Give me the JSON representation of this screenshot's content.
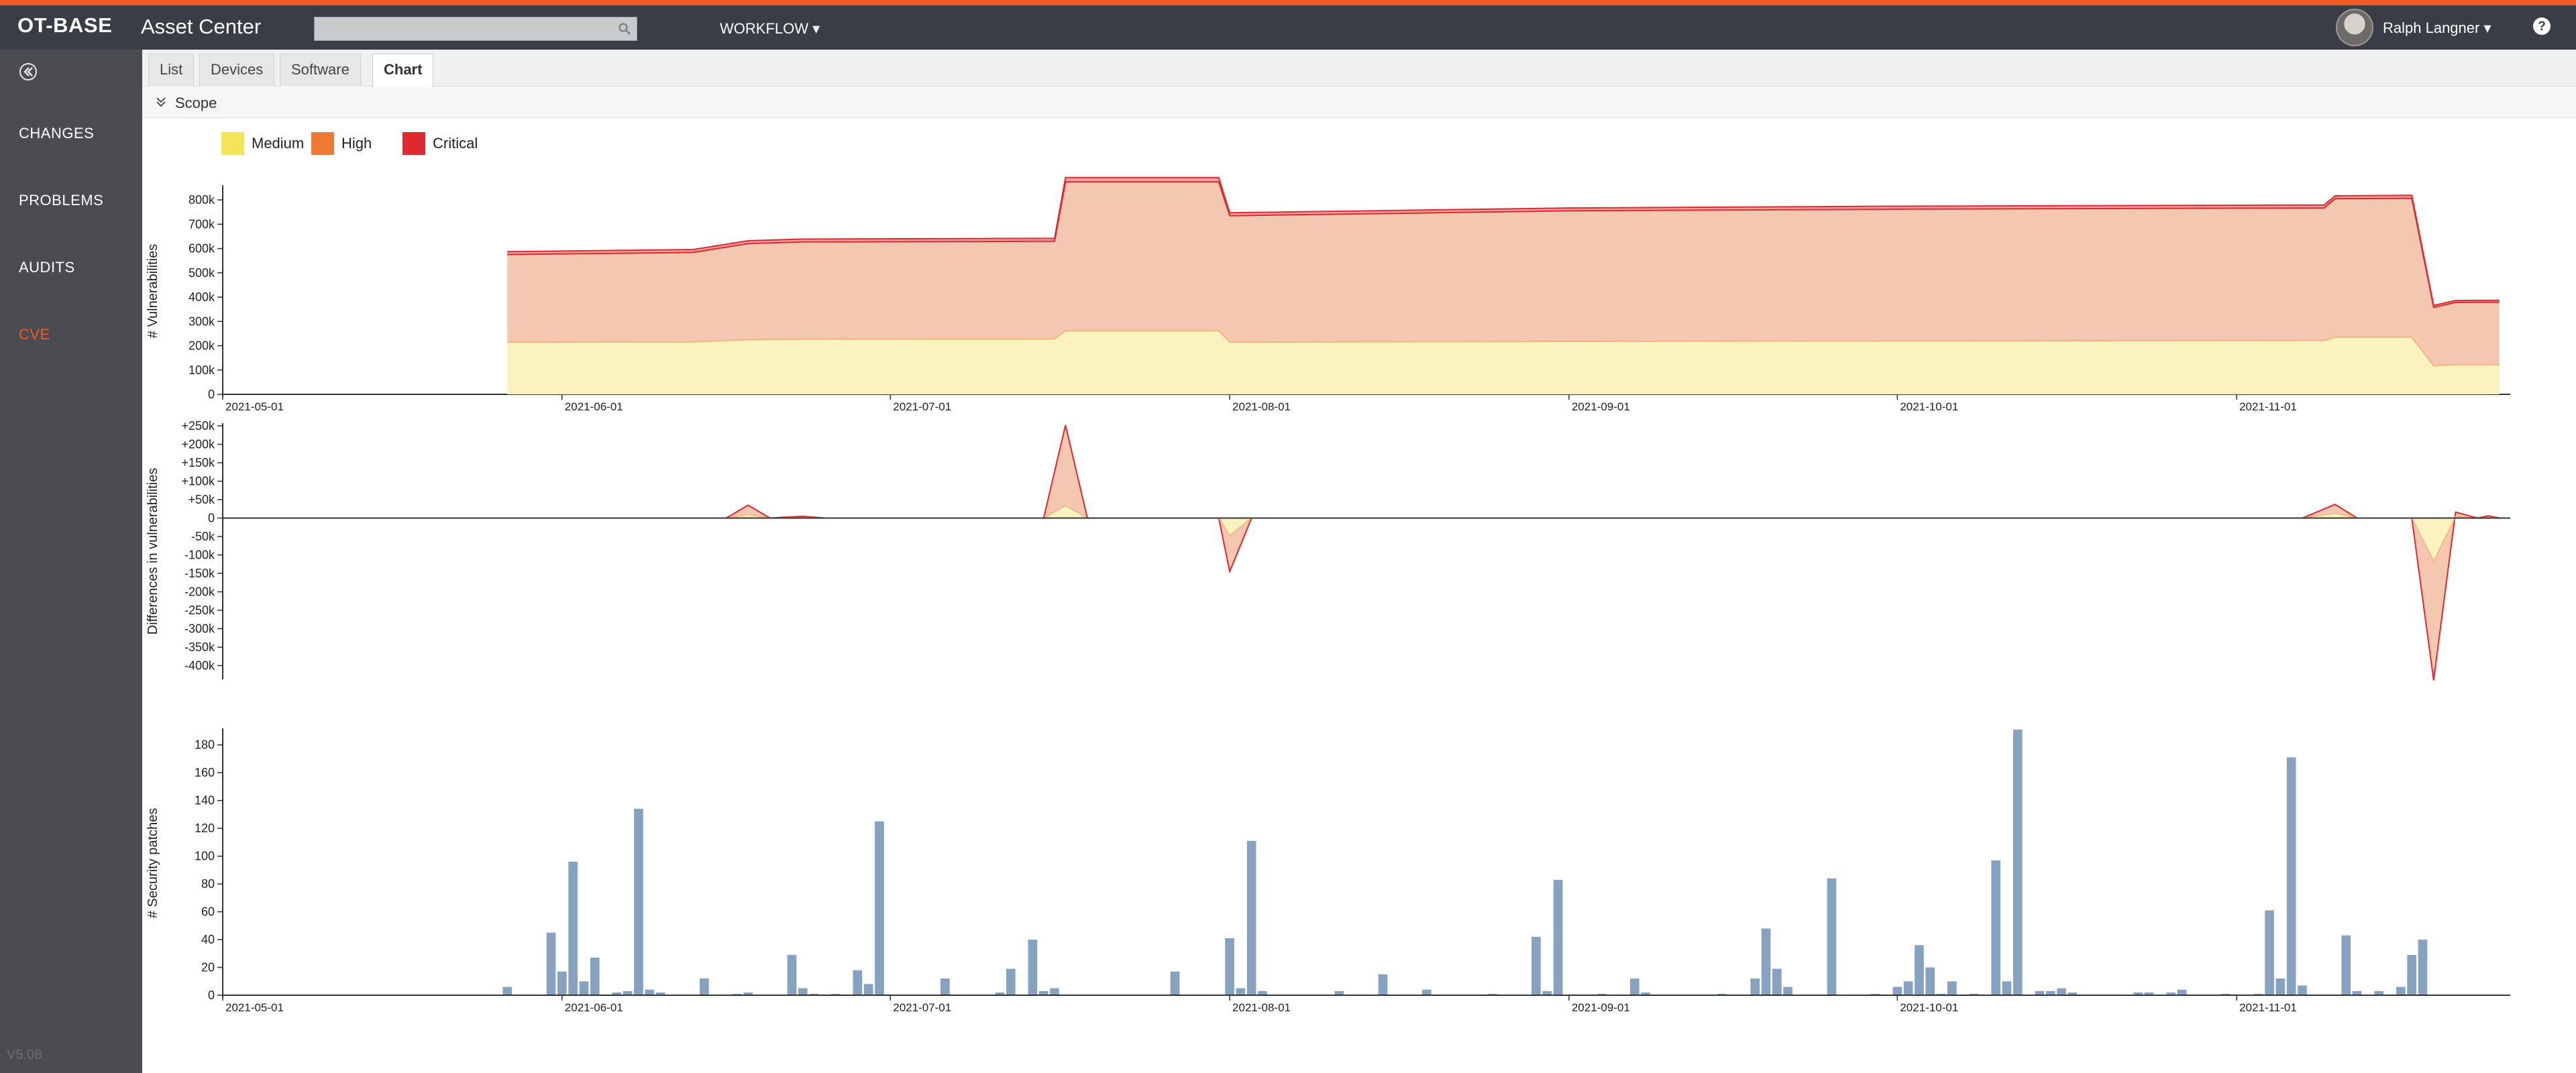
{
  "header": {
    "brand": "OT-BASE",
    "app_name": "Asset Center",
    "search": {
      "value": "",
      "placeholder": ""
    },
    "workflow_label": "WORKFLOW ▾",
    "user_name": "Ralph Langner ▾"
  },
  "sidebar": {
    "items": [
      {
        "label": "CHANGES",
        "active": false
      },
      {
        "label": "PROBLEMS",
        "active": false
      },
      {
        "label": "AUDITS",
        "active": false
      },
      {
        "label": "CVE",
        "active": true
      }
    ],
    "version": "V5.08"
  },
  "tabs": [
    {
      "label": "List",
      "active": false
    },
    {
      "label": "Devices",
      "active": false
    },
    {
      "label": "Software",
      "active": false
    },
    {
      "label": "Chart",
      "active": true
    }
  ],
  "scope": {
    "label": "Scope"
  },
  "colors": {
    "accent": "#f15a22",
    "medium": "#f5e556",
    "high": "#ee7a33",
    "critical": "#dc2a30",
    "medium_fill": "#faf3bf",
    "high_fill": "#f4c7b0",
    "bars": "#87a2c0"
  },
  "chart_data": [
    {
      "type": "area",
      "stacked": true,
      "ylabel": "# Vulnerabilities",
      "x_ticks": [
        "2021-05-01",
        "2021-06-01",
        "2021-07-01",
        "2021-08-01",
        "2021-09-01",
        "2021-10-01",
        "2021-11-01"
      ],
      "y_ticks": [
        "0",
        "100k",
        "200k",
        "300k",
        "400k",
        "500k",
        "600k",
        "700k",
        "800k"
      ],
      "ylim": [
        0,
        850000
      ],
      "legend": [
        "Medium",
        "High",
        "Critical"
      ],
      "points": [
        {
          "x": "2021-05-27",
          "medium": 215000,
          "high": 360000,
          "critical": 12000
        },
        {
          "x": "2021-06-13",
          "medium": 216000,
          "high": 368000,
          "critical": 12000
        },
        {
          "x": "2021-06-18",
          "medium": 225000,
          "high": 395000,
          "critical": 12000
        },
        {
          "x": "2021-06-23",
          "medium": 227000,
          "high": 400000,
          "critical": 12000
        },
        {
          "x": "2021-07-16",
          "medium": 228000,
          "high": 402000,
          "critical": 12000
        },
        {
          "x": "2021-07-17",
          "medium": 262000,
          "high": 612000,
          "critical": 18000
        },
        {
          "x": "2021-07-31",
          "medium": 262000,
          "high": 612000,
          "critical": 18000
        },
        {
          "x": "2021-08-01",
          "medium": 215000,
          "high": 520000,
          "critical": 12000
        },
        {
          "x": "2021-09-01",
          "medium": 218000,
          "high": 537000,
          "critical": 12000
        },
        {
          "x": "2021-10-01",
          "medium": 220000,
          "high": 542000,
          "critical": 12000
        },
        {
          "x": "2021-11-09",
          "medium": 222000,
          "high": 545000,
          "critical": 12000
        },
        {
          "x": "2021-11-10",
          "medium": 235000,
          "high": 570000,
          "critical": 12000
        },
        {
          "x": "2021-11-17",
          "medium": 235000,
          "high": 572000,
          "critical": 12000
        },
        {
          "x": "2021-11-19",
          "medium": 118000,
          "high": 240000,
          "critical": 8000
        },
        {
          "x": "2021-11-21",
          "medium": 122000,
          "high": 256000,
          "critical": 8000
        },
        {
          "x": "2021-11-25",
          "medium": 122000,
          "high": 257000,
          "critical": 8000
        }
      ]
    },
    {
      "type": "area",
      "ylabel": "Differences in vulnerabilities",
      "x_ticks": [],
      "y_ticks": [
        "+250k",
        "+200k",
        "+150k",
        "+100k",
        "+50k",
        "0",
        "-50k",
        "-100k",
        "-150k",
        "-200k",
        "-250k",
        "-300k",
        "-350k",
        "-400k"
      ],
      "ylim": [
        -420000,
        260000
      ],
      "legend": [
        "Medium",
        "High",
        "Critical"
      ],
      "points": [
        {
          "x": "2021-05-27",
          "medium": 0,
          "total": 0
        },
        {
          "x": "2021-06-16",
          "medium": 0,
          "total": 0
        },
        {
          "x": "2021-06-18",
          "medium": 9000,
          "total": 35000
        },
        {
          "x": "2021-06-20",
          "medium": 0,
          "total": 0
        },
        {
          "x": "2021-06-23",
          "medium": 1500,
          "total": 5000
        },
        {
          "x": "2021-06-25",
          "medium": 0,
          "total": 0
        },
        {
          "x": "2021-07-15",
          "medium": 0,
          "total": 0
        },
        {
          "x": "2021-07-17",
          "medium": 34000,
          "total": 252000
        },
        {
          "x": "2021-07-19",
          "medium": 0,
          "total": 0
        },
        {
          "x": "2021-07-31",
          "medium": 0,
          "total": 0
        },
        {
          "x": "2021-08-01",
          "medium": -47000,
          "total": -145000
        },
        {
          "x": "2021-08-03",
          "medium": 0,
          "total": 0
        },
        {
          "x": "2021-11-07",
          "medium": 0,
          "total": 0
        },
        {
          "x": "2021-11-10",
          "medium": 13000,
          "total": 37000
        },
        {
          "x": "2021-11-12",
          "medium": 0,
          "total": 0
        },
        {
          "x": "2021-11-17",
          "medium": 0,
          "total": 0
        },
        {
          "x": "2021-11-19",
          "medium": -117000,
          "total": -440000
        },
        {
          "x": "2021-11-21",
          "medium": 4000,
          "total": 16000
        },
        {
          "x": "2021-11-23",
          "medium": 0,
          "total": 0
        },
        {
          "x": "2021-11-24",
          "medium": 2000,
          "total": 6000
        },
        {
          "x": "2021-11-25",
          "medium": 0,
          "total": 0
        }
      ]
    },
    {
      "type": "bar",
      "ylabel": "# Security patches",
      "x_ticks": [
        "2021-05-01",
        "2021-06-01",
        "2021-07-01",
        "2021-08-01",
        "2021-09-01",
        "2021-10-01",
        "2021-11-01"
      ],
      "y_ticks": [
        "0",
        "20",
        "40",
        "60",
        "80",
        "100",
        "120",
        "140",
        "160",
        "180"
      ],
      "ylim": [
        0,
        190
      ],
      "bars": [
        {
          "x": "2021-05-27",
          "value": 6
        },
        {
          "x": "2021-05-31",
          "value": 45
        },
        {
          "x": "2021-06-01",
          "value": 17
        },
        {
          "x": "2021-06-02",
          "value": 96
        },
        {
          "x": "2021-06-03",
          "value": 10
        },
        {
          "x": "2021-06-04",
          "value": 27
        },
        {
          "x": "2021-06-06",
          "value": 2
        },
        {
          "x": "2021-06-07",
          "value": 3
        },
        {
          "x": "2021-06-08",
          "value": 134
        },
        {
          "x": "2021-06-09",
          "value": 4
        },
        {
          "x": "2021-06-10",
          "value": 2
        },
        {
          "x": "2021-06-14",
          "value": 12
        },
        {
          "x": "2021-06-17",
          "value": 1
        },
        {
          "x": "2021-06-18",
          "value": 2
        },
        {
          "x": "2021-06-22",
          "value": 29
        },
        {
          "x": "2021-06-23",
          "value": 5
        },
        {
          "x": "2021-06-24",
          "value": 1
        },
        {
          "x": "2021-06-26",
          "value": 1
        },
        {
          "x": "2021-06-28",
          "value": 18
        },
        {
          "x": "2021-06-29",
          "value": 8
        },
        {
          "x": "2021-06-30",
          "value": 125
        },
        {
          "x": "2021-07-06",
          "value": 12
        },
        {
          "x": "2021-07-11",
          "value": 2
        },
        {
          "x": "2021-07-12",
          "value": 19
        },
        {
          "x": "2021-07-14",
          "value": 40
        },
        {
          "x": "2021-07-15",
          "value": 3
        },
        {
          "x": "2021-07-16",
          "value": 5
        },
        {
          "x": "2021-07-27",
          "value": 17
        },
        {
          "x": "2021-08-01",
          "value": 41
        },
        {
          "x": "2021-08-02",
          "value": 5
        },
        {
          "x": "2021-08-03",
          "value": 111
        },
        {
          "x": "2021-08-04",
          "value": 3
        },
        {
          "x": "2021-08-11",
          "value": 3
        },
        {
          "x": "2021-08-15",
          "value": 15
        },
        {
          "x": "2021-08-19",
          "value": 4
        },
        {
          "x": "2021-08-25",
          "value": 1
        },
        {
          "x": "2021-08-29",
          "value": 42
        },
        {
          "x": "2021-08-30",
          "value": 3
        },
        {
          "x": "2021-08-31",
          "value": 83
        },
        {
          "x": "2021-09-04",
          "value": 1
        },
        {
          "x": "2021-09-07",
          "value": 12
        },
        {
          "x": "2021-09-08",
          "value": 2
        },
        {
          "x": "2021-09-15",
          "value": 1
        },
        {
          "x": "2021-09-18",
          "value": 12
        },
        {
          "x": "2021-09-19",
          "value": 48
        },
        {
          "x": "2021-09-20",
          "value": 19
        },
        {
          "x": "2021-09-21",
          "value": 6
        },
        {
          "x": "2021-09-25",
          "value": 84
        },
        {
          "x": "2021-09-29",
          "value": 1
        },
        {
          "x": "2021-10-01",
          "value": 6
        },
        {
          "x": "2021-10-02",
          "value": 10
        },
        {
          "x": "2021-10-03",
          "value": 36
        },
        {
          "x": "2021-10-04",
          "value": 20
        },
        {
          "x": "2021-10-05",
          "value": 1
        },
        {
          "x": "2021-10-06",
          "value": 10
        },
        {
          "x": "2021-10-08",
          "value": 1
        },
        {
          "x": "2021-10-10",
          "value": 97
        },
        {
          "x": "2021-10-11",
          "value": 10
        },
        {
          "x": "2021-10-12",
          "value": 191
        },
        {
          "x": "2021-10-14",
          "value": 3
        },
        {
          "x": "2021-10-15",
          "value": 3
        },
        {
          "x": "2021-10-16",
          "value": 5
        },
        {
          "x": "2021-10-17",
          "value": 2
        },
        {
          "x": "2021-10-23",
          "value": 2
        },
        {
          "x": "2021-10-24",
          "value": 2
        },
        {
          "x": "2021-10-26",
          "value": 2
        },
        {
          "x": "2021-10-27",
          "value": 4
        },
        {
          "x": "2021-10-31",
          "value": 1
        },
        {
          "x": "2021-11-03",
          "value": 1
        },
        {
          "x": "2021-11-04",
          "value": 61
        },
        {
          "x": "2021-11-05",
          "value": 12
        },
        {
          "x": "2021-11-06",
          "value": 171
        },
        {
          "x": "2021-11-07",
          "value": 7
        },
        {
          "x": "2021-11-11",
          "value": 43
        },
        {
          "x": "2021-11-12",
          "value": 3
        },
        {
          "x": "2021-11-14",
          "value": 3
        },
        {
          "x": "2021-11-16",
          "value": 6
        },
        {
          "x": "2021-11-17",
          "value": 29
        },
        {
          "x": "2021-11-18",
          "value": 40
        }
      ]
    }
  ]
}
